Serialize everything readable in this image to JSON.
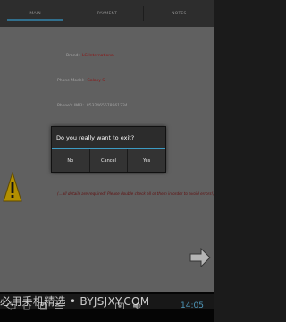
{
  "tabs": [
    {
      "label": "MAIN",
      "active": true
    },
    {
      "label": "PAYMENT",
      "active": false
    },
    {
      "label": "NOTES",
      "active": false
    }
  ],
  "form": {
    "brand": {
      "label": "Brand:",
      "value": "LG International"
    },
    "phone_model": {
      "label": "Phone Model:",
      "value": "Galaxy S"
    },
    "phone_imei": {
      "label": "Phone's IMEI:",
      "value": "8532465678961234"
    }
  },
  "required_message": "(...all details are required! Please double check all of them in order to avoid errors!)",
  "dialog": {
    "title": "Do you really want to exit?",
    "buttons": [
      "No",
      "Cancel",
      "Yes"
    ]
  },
  "status": {
    "clock": "14:05"
  },
  "watermark": "必用手机精选 • BYJSJXY.COM",
  "colors": {
    "accent": "#3f8fb5",
    "value_text": "#b31d1d",
    "warning": "#e5b800"
  },
  "icons": [
    "warning-icon",
    "next-arrow-icon",
    "back-icon",
    "home-icon",
    "recent-apps-icon",
    "menu-icon",
    "screenshot-icon",
    "volume-icon"
  ]
}
